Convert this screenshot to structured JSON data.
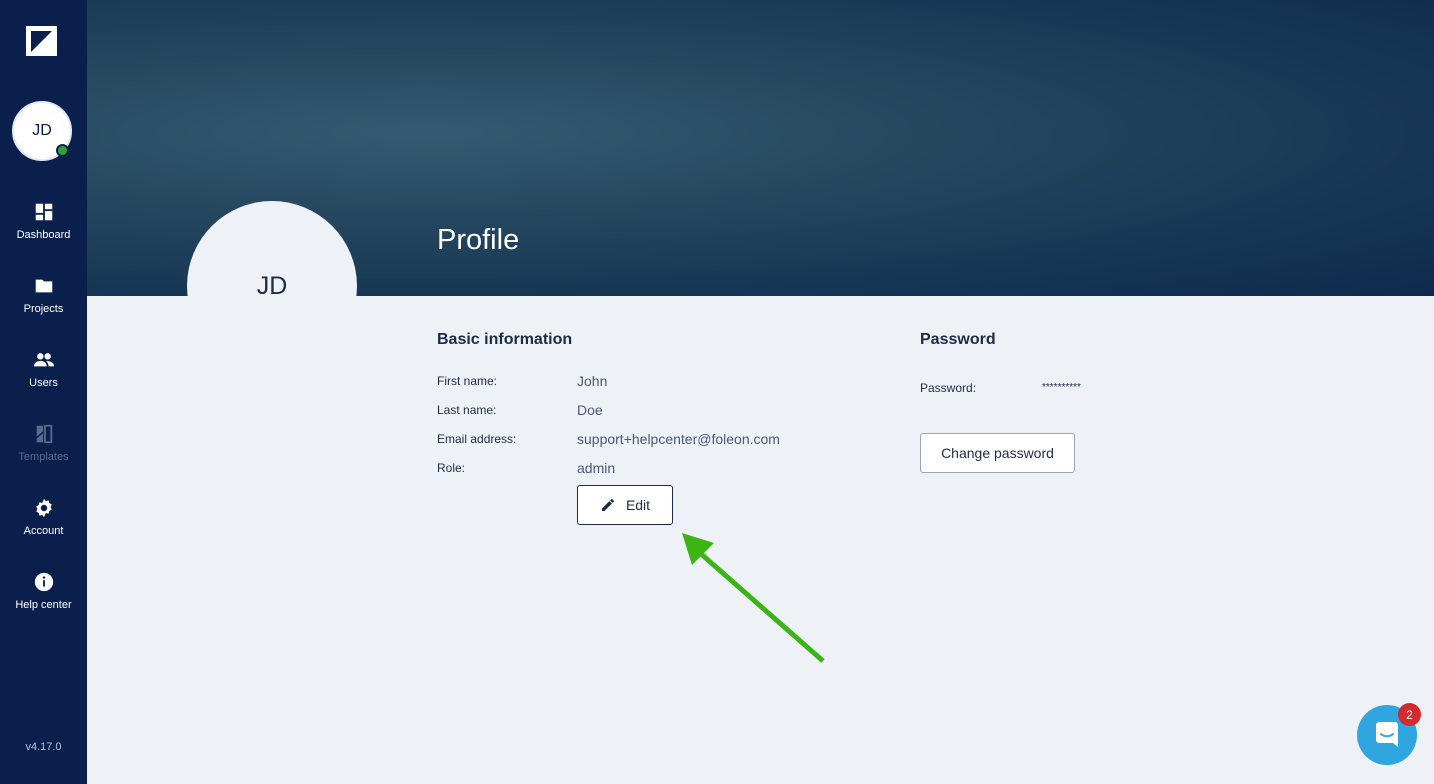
{
  "sidebar": {
    "avatar_initials": "JD",
    "items": [
      {
        "label": "Dashboard",
        "icon": "dashboard-icon"
      },
      {
        "label": "Projects",
        "icon": "folder-icon"
      },
      {
        "label": "Users",
        "icon": "users-icon"
      },
      {
        "label": "Templates",
        "icon": "templates-icon",
        "disabled": true
      },
      {
        "label": "Account",
        "icon": "gear-icon"
      },
      {
        "label": "Help center",
        "icon": "info-icon"
      }
    ],
    "version": "v4.17.0"
  },
  "header": {
    "avatar_initials": "JD",
    "title": "Profile"
  },
  "basic_info": {
    "title": "Basic information",
    "fields": [
      {
        "label": "First name:",
        "value": "John"
      },
      {
        "label": "Last name:",
        "value": "Doe"
      },
      {
        "label": "Email address:",
        "value": "support+helpcenter@foleon.com"
      },
      {
        "label": "Role:",
        "value": "admin"
      }
    ],
    "edit_label": "Edit"
  },
  "password": {
    "title": "Password",
    "label": "Password:",
    "value": "**********",
    "change_label": "Change password"
  },
  "chat": {
    "badge_count": "2"
  },
  "colors": {
    "sidebar": "#0b1f4d",
    "online": "#2fa33a",
    "chat": "#2fa6e0",
    "badge": "#d22a2f",
    "arrow": "#3cb414"
  }
}
